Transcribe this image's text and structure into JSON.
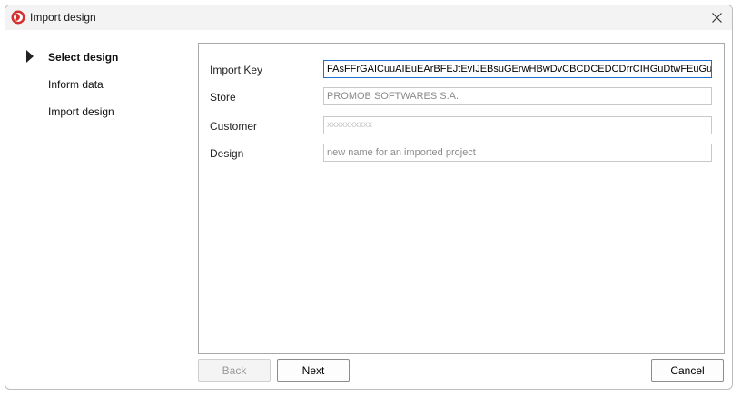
{
  "window": {
    "title": "Import design"
  },
  "steps": [
    {
      "label": "Select design",
      "active": true
    },
    {
      "label": "Inform data",
      "active": false
    },
    {
      "label": "Import design",
      "active": false
    }
  ],
  "form": {
    "import_key": {
      "label": "Import Key",
      "value": "FAsFFrGAICuuAIEuEArBFEJtEvIJEBsuGErwHBwDvCBCDCEDCDrrCIHGuDtwFEuGuB"
    },
    "store": {
      "label": "Store",
      "value": "PROMOB SOFTWARES S.A."
    },
    "customer": {
      "label": "Customer",
      "placeholder": "xxxxxxxxxx"
    },
    "design": {
      "label": "Design",
      "value": "new name for an imported project"
    }
  },
  "buttons": {
    "back": "Back",
    "next": "Next",
    "cancel": "Cancel"
  },
  "colors": {
    "accent": "#1f6fd0",
    "app_icon": "#d32f2f"
  }
}
